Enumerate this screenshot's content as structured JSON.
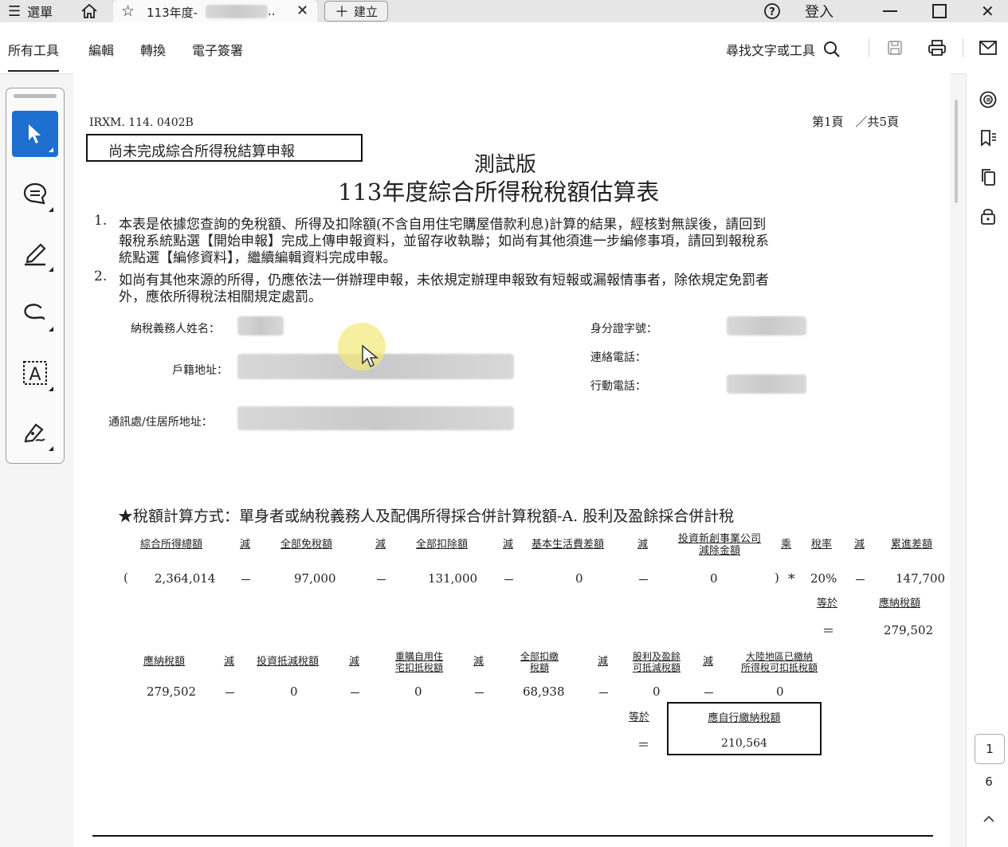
{
  "titlebar": {
    "menu_label": "選單",
    "tab_title": "113年度-",
    "tab_ellipsis": "..",
    "new_label": "建立",
    "login_label": "登入"
  },
  "toolbar": {
    "menu_all_tools": "所有工具",
    "menu_edit": "編輯",
    "menu_convert": "轉換",
    "menu_esign": "電子簽署",
    "search_label": "尋找文字或工具"
  },
  "page_nav": {
    "current_page": "1",
    "total_pages": "6"
  },
  "document": {
    "form_code": "IRXM. 114. 0402B",
    "page_indicator": "第1頁　／共5頁",
    "status_box": "尚未完成綜合所得稅結算申報",
    "watermark_title": "測試版",
    "main_title": "113年度綜合所得稅稅額估算表",
    "note1_num": "1.",
    "note1_lines": [
      "本表是依據您查詢的免稅額、所得及扣除額(不含自用住宅購屋借款利息)計算的結果，經核對無誤後，請回到",
      "報稅系統點選【開始申報】完成上傳申報資料，並留存收執聯；如尚有其他須進一步編修事項，請回到報稅系",
      "統點選【編修資料】，繼續編輯資料完成申報。"
    ],
    "note2_num": "2.",
    "note2_lines": [
      "如尚有其他來源的所得，仍應依法一併辦理申報，未依規定辦理申報致有短報或漏報情事者，除依規定免罰者",
      "外，應依所得稅法相關規定處罰。"
    ],
    "fields": {
      "taxpayer_name_label": "納稅義務人姓名：",
      "household_address_label": "戶籍地址：",
      "mailing_address_label": "通訊處/住居所地址：",
      "id_number_label": "身分證字號：",
      "phone_label": "連絡電話：",
      "mobile_label": "行動電話："
    },
    "calc_title": "★稅額計算方式：單身者或納稅義務人及配偶所得採合併計算稅額-A. 股利及盈餘採合併計稅",
    "row1": {
      "h_total_income": "綜合所得總額",
      "h_minus1": "減",
      "h_exemptions": "全部免稅額",
      "h_minus2": "減",
      "h_deductions": "全部扣除額",
      "h_minus3": "減",
      "h_basic_living": "基本生活費差額",
      "h_minus4": "減",
      "h_startup_line1": "投資新創事業公司",
      "h_startup_line2": "減除金額",
      "h_multiply": "乘",
      "h_rate": "稅率",
      "h_minus5": "減",
      "h_progressive": "累進差額",
      "open_paren": "(",
      "v_total_income": "2,364,014",
      "dash1": "－",
      "v_exemptions": "97,000",
      "dash2": "－",
      "v_deductions": "131,000",
      "dash3": "－",
      "v_basic_living": "0",
      "dash4": "－",
      "v_startup": "0",
      "close_paren": ")",
      "star": "*",
      "v_rate": "20%",
      "dash5": "－",
      "v_progressive": "147,700",
      "h_equals": "等於",
      "h_tax_payable": "應納稅額",
      "eq_sign": "＝",
      "v_tax_payable": "279,502"
    },
    "row2": {
      "h_tax_payable": "應納稅額",
      "h_minus1": "減",
      "h_invest_credit": "投資抵減稅額",
      "h_minus2": "減",
      "h_rebuy_line1": "重購自用住",
      "h_rebuy_line2": "宅扣抵稅額",
      "h_minus3": "減",
      "h_withheld_line1": "全部扣繳",
      "h_withheld_line2": "稅額",
      "h_minus4": "減",
      "h_dividend_line1": "股利及盈餘",
      "h_dividend_line2": "可抵減稅額",
      "h_minus5": "減",
      "h_mainland_line1": "大陸地區已繳納",
      "h_mainland_line2": "所得稅可扣抵稅額",
      "v_tax_payable": "279,502",
      "dash1": "－",
      "v_invest_credit": "0",
      "dash2": "－",
      "v_rebuy": "0",
      "dash3": "－",
      "v_withheld": "68,938",
      "dash4": "－",
      "v_dividend": "0",
      "dash5": "－",
      "v_mainland": "0",
      "h_equals": "等於",
      "h_self_pay": "應自行繳納稅額",
      "eq_sign": "＝",
      "v_self_pay": "210,564"
    }
  }
}
